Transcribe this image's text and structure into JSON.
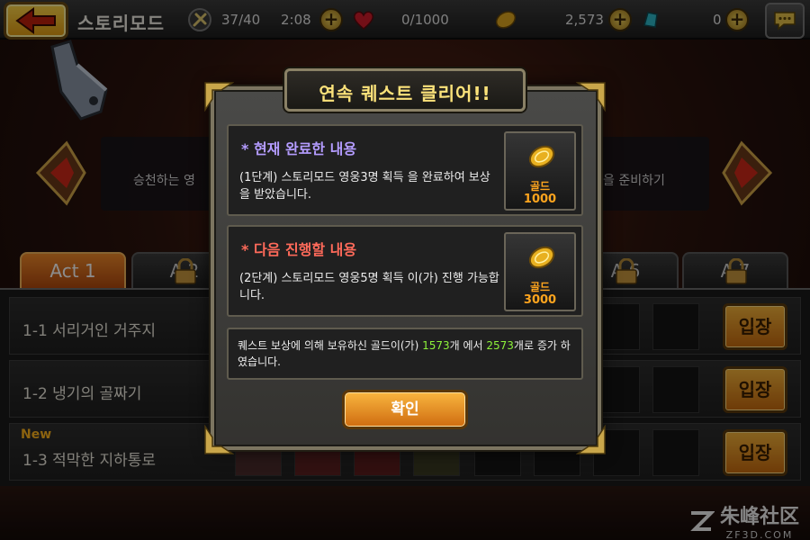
{
  "colors": {
    "accent_orange": "#e88a20",
    "gold_text": "#fbe27a",
    "completed_heading": "#b49cff",
    "next_heading": "#ff6a5a",
    "reward_text": "#ffa51e",
    "highlight_green": "#8df23a"
  },
  "topbar": {
    "mode_title": "스토리모드",
    "stamina": "37/40",
    "timer": "2:08",
    "hearts": "0/1000",
    "gold": "2,573",
    "gems": "0"
  },
  "background": {
    "banner_left": "승천하는 영",
    "banner_right": "을 준비하기",
    "tabs": [
      {
        "label": "Act 1"
      },
      {
        "label": "A  2"
      },
      {
        "label": "A  6"
      },
      {
        "label": "A  7"
      }
    ],
    "stages": [
      {
        "name": "1-1 서리거인 거주지",
        "badge": "",
        "enter": "입장"
      },
      {
        "name": "1-2 냉기의 골짜기",
        "badge": "",
        "enter": "입장"
      },
      {
        "name": "1-3 적막한 지하통로",
        "badge": "New",
        "enter": "입장"
      }
    ]
  },
  "modal": {
    "title": "연속 퀘스트 클리어!!",
    "completed": {
      "heading": "* 현재 완료한 내용",
      "text": "(1단계) 스토리모드 영웅3명 획득 을 완료하여 보상을 받았습니다.",
      "reward_label": "골드",
      "reward_amount": "1000"
    },
    "next": {
      "heading": "* 다음 진행할 내용",
      "text": "(2단계) 스토리모드 영웅5명 획득 이(가) 진행 가능합니다.",
      "reward_label": "골드",
      "reward_amount": "3000"
    },
    "info": {
      "prefix": "퀘스트 보상에 의해 보유하신 골드이(가) ",
      "old_gold": "1573",
      "middle": "개 에서 ",
      "new_gold": "2573",
      "suffix": "개로 증가 하였습니다."
    },
    "confirm": "확인"
  },
  "watermark": {
    "cn": "朱峰社区",
    "en": "ZF3D.COM"
  }
}
